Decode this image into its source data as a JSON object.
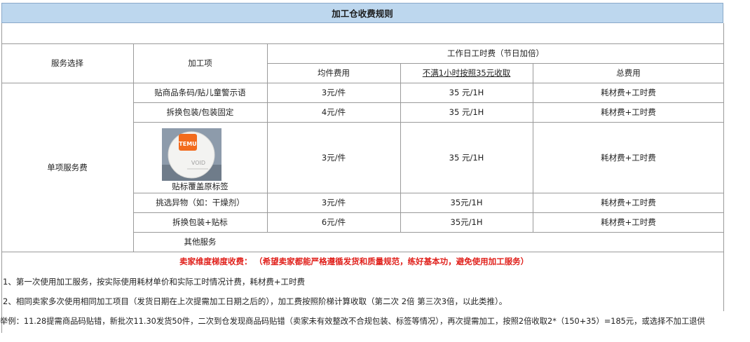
{
  "title": "加工仓收费规则",
  "headers": {
    "service_select": "服务选择",
    "process_item": "加工项",
    "workday_fee": "工作日工时费（节日加倍）",
    "per_piece": "均件费用",
    "under_hour": "不满1小时按照35元收取",
    "total": "总费用"
  },
  "group_label": "单项服务费",
  "rows": [
    {
      "item": "贴商品条码/贴儿童警示语",
      "per_piece": "3元/件",
      "hourly": "35 元/1H",
      "total": "耗材费+工时费"
    },
    {
      "item": "拆换包装/包装固定",
      "per_piece": "4元/件",
      "hourly": "35 元/1H",
      "total": "耗材费+工时费"
    },
    {
      "item": "贴标覆盖原标签",
      "per_piece": "3元/件",
      "hourly": "35 元/1H",
      "total": "耗材费+工时费"
    },
    {
      "item": "挑选异物（如：干燥剂）",
      "per_piece": "3元/件",
      "hourly": "35元/1H",
      "total": "耗材费+工时费"
    },
    {
      "item": "拆换包装+贴标",
      "per_piece": "6元/件",
      "hourly": "35元/1H",
      "total": "耗材费+工时费"
    },
    {
      "item": "其他服务",
      "per_piece": "",
      "hourly": "",
      "total": ""
    }
  ],
  "thumbnail": {
    "sticker_text": "TEMU",
    "stamp_text": "VOID"
  },
  "notes": {
    "tier_label": "卖家维度梯度收费：",
    "tier_hint": "（希望卖家都能严格遵循发货和质量规范，练好基本功，避免使用加工服务）",
    "line1": "1、第一次使用加工服务，按实际使用耗材单价和实际工时情况计费，耗材费+工时费",
    "line2": "2、相同卖家多次使用相同加工项目（发货日期在上次提需加工日期之后的），加工费按照阶梯计算收取（第二次 2倍 第三次3倍，以此类推）。",
    "example": "举例：11.28提需商品码贴错，新批次11.30发货50件，二次到仓发现商品码贴错（卖家未有效整改不合规包装、标签等情况），再次提需加工，按照2倍收取2*（150+35）=185元，或选择不加工退供"
  },
  "colors": {
    "title_bg": "#bdd7ee",
    "grid": "#9a9a9a",
    "red": "#e0201b"
  }
}
